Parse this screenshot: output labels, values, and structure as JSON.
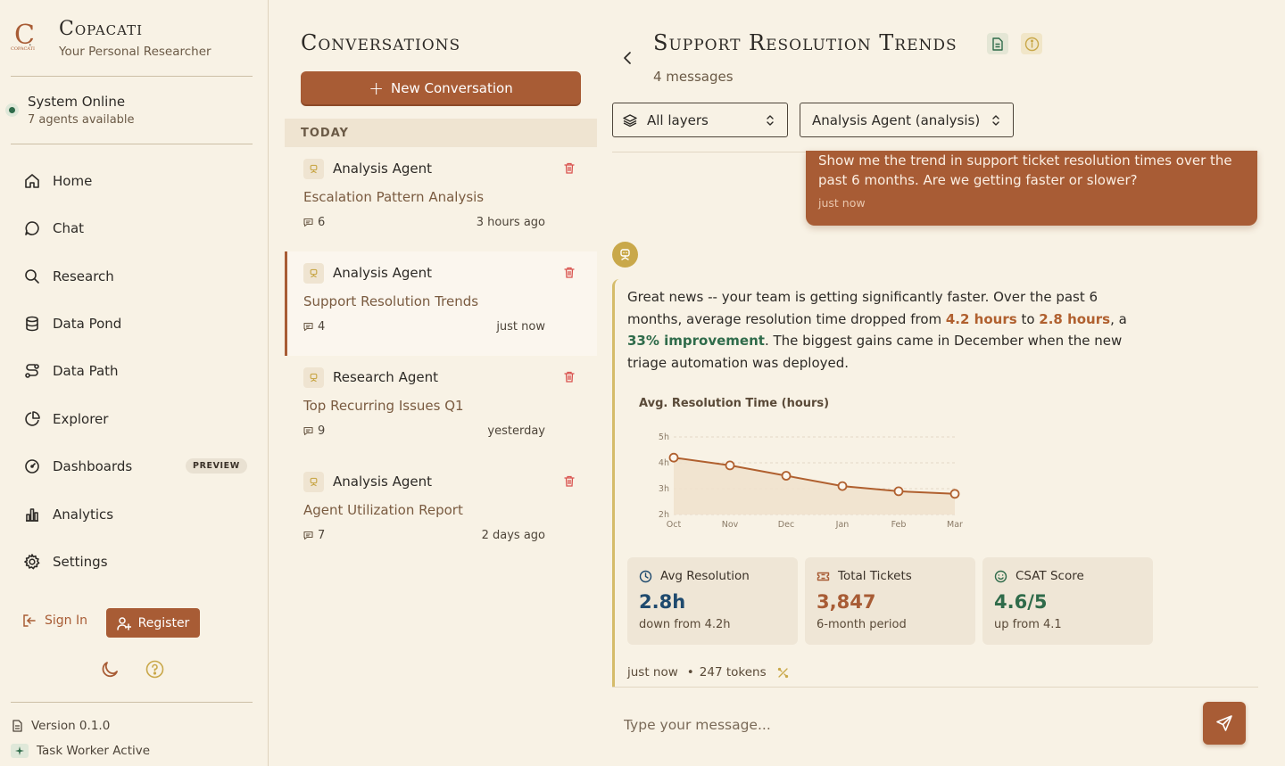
{
  "brand": {
    "name": "Copacati",
    "subtitle": "Your Personal Researcher",
    "logo_letter": "C",
    "logo_caption": "COPACATI"
  },
  "status": {
    "title": "System Online",
    "subtitle": "7 agents available"
  },
  "nav": [
    {
      "label": "Home",
      "icon": "home-icon"
    },
    {
      "label": "Chat",
      "icon": "chat-bubble-icon"
    },
    {
      "label": "Research",
      "icon": "search-icon"
    },
    {
      "label": "Data Pond",
      "icon": "database-icon"
    },
    {
      "label": "Data Path",
      "icon": "route-icon"
    },
    {
      "label": "Explorer",
      "icon": "pie-chart-icon"
    },
    {
      "label": "Dashboards",
      "icon": "gauge-icon",
      "badge": "PREVIEW"
    },
    {
      "label": "Analytics",
      "icon": "bar-chart-icon"
    },
    {
      "label": "Settings",
      "icon": "gear-icon"
    }
  ],
  "auth": {
    "signin": "Sign In",
    "register": "Register"
  },
  "footer": {
    "version": "Version 0.1.0",
    "worker": "Task Worker Active"
  },
  "conversations": {
    "title": "Conversations",
    "new_button": "New Conversation",
    "group_label": "TODAY",
    "items": [
      {
        "agent": "Analysis Agent",
        "title": "Escalation Pattern Analysis",
        "count": "6",
        "time": "3 hours ago",
        "active": false
      },
      {
        "agent": "Analysis Agent",
        "title": "Support Resolution Trends",
        "count": "4",
        "time": "just now",
        "active": true
      },
      {
        "agent": "Research Agent",
        "title": "Top Recurring Issues Q1",
        "count": "9",
        "time": "yesterday",
        "active": false
      },
      {
        "agent": "Analysis Agent",
        "title": "Agent Utilization Report",
        "count": "7",
        "time": "2 days ago",
        "active": false
      }
    ]
  },
  "chat": {
    "title": "Support Resolution Trends",
    "message_count": "4 messages",
    "layer_select": "All layers",
    "agent_select": "Analysis Agent (analysis)",
    "user_message": {
      "text": "Show me the trend in support ticket resolution times over the past 6 months. Are we getting faster or slower?",
      "time": "just now"
    },
    "bot_message": {
      "text_1": "Great news -- your team is getting significantly faster. Over the past 6 months, average resolution time dropped from ",
      "hl_1": "4.2 hours",
      "text_2": " to ",
      "hl_2": "2.8 hours",
      "text_3": ", a ",
      "hl_3": "33% improvement",
      "text_4": ". The biggest gains came in December when the new triage automation was deployed.",
      "time": "just now",
      "tokens": "247 tokens"
    },
    "stats": [
      {
        "label": "Avg Resolution",
        "value": "2.8h",
        "sub": "down from 4.2h",
        "icon": "clock-icon",
        "color": "#1f4a6e"
      },
      {
        "label": "Total Tickets",
        "value": "3,847",
        "sub": "6-month period",
        "icon": "ticket-icon",
        "color": "#a85c35"
      },
      {
        "label": "CSAT Score",
        "value": "4.6/5",
        "sub": "up from 4.1",
        "icon": "smile-icon",
        "color": "#2f6b4a"
      }
    ],
    "input_placeholder": "Type your message..."
  },
  "chart_data": {
    "type": "area",
    "title": "Avg. Resolution Time (hours)",
    "categories": [
      "Oct",
      "Nov",
      "Dec",
      "Jan",
      "Feb",
      "Mar"
    ],
    "series": [
      {
        "values": [
          4.2,
          3.9,
          3.5,
          3.1,
          2.9,
          2.8
        ]
      }
    ],
    "ylim": [
      2,
      5
    ],
    "yticks": [
      "2h",
      "3h",
      "4h",
      "5h"
    ],
    "grid": true,
    "colors": {
      "line": "#b0602f",
      "fill": "#f0e2cc"
    }
  }
}
